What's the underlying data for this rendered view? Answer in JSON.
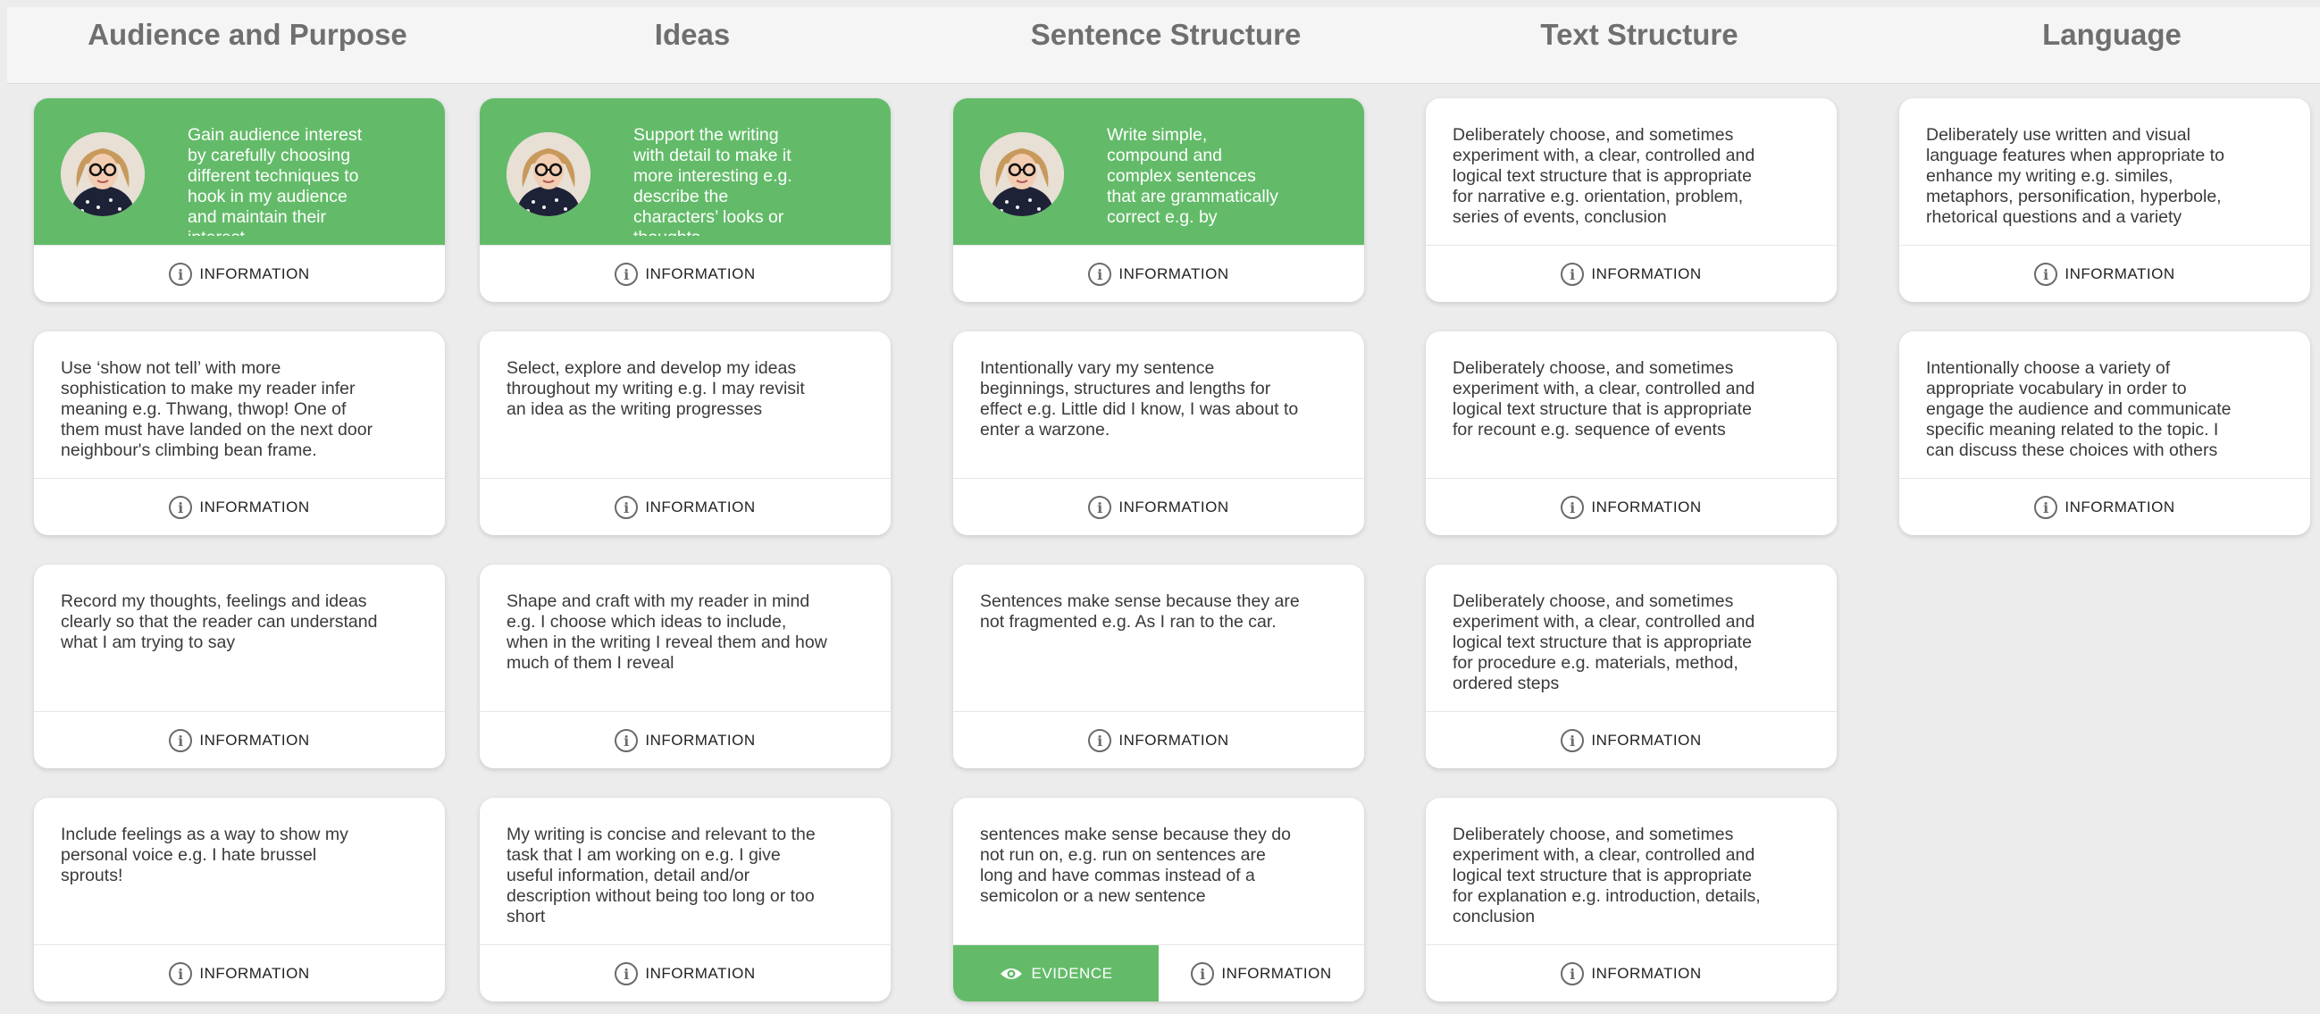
{
  "columns": [
    {
      "title": "Audience and Purpose",
      "cards": [
        {
          "text": "Gain audience interest by carefully choosing different techniques to hook in my audience and maintain their interest",
          "selected": true,
          "info_label": "INFORMATION"
        },
        {
          "text": "Use ‘show not tell’ with more sophistication to make my reader infer meaning e.g. Thwang, thwop! One of them must have landed on the next door neighbour's climbing bean frame.",
          "info_label": "INFORMATION"
        },
        {
          "text": "Record my thoughts, feelings and ideas clearly so that the reader can understand what I am trying to say",
          "info_label": "INFORMATION"
        },
        {
          "text": "Include feelings as a way to show my personal voice e.g. I hate brussel sprouts!",
          "info_label": "INFORMATION"
        }
      ]
    },
    {
      "title": "Ideas",
      "cards": [
        {
          "text": "Support the writing with detail to make it more interesting e.g. describe the characters’ looks or thoughts",
          "selected": true,
          "info_label": "INFORMATION"
        },
        {
          "text": "Select, explore and develop my ideas throughout my writing e.g. I may revisit an idea as the writing progresses",
          "info_label": "INFORMATION"
        },
        {
          "text": "Shape and craft with my reader in mind e.g. I choose which ideas to include, when in the writing I reveal them and how much of them I reveal",
          "info_label": "INFORMATION"
        },
        {
          "text": "My writing is concise and relevant to the task that I am working on e.g. I give useful information, detail and/or description without being too long or too short",
          "info_label": "INFORMATION"
        }
      ]
    },
    {
      "title": "Sentence Structure",
      "cards": [
        {
          "text": "Write simple, compound and complex sentences that are grammatically correct e.g. by",
          "selected": true,
          "info_label": "INFORMATION"
        },
        {
          "text": "Intentionally vary my sentence beginnings, structures and lengths for effect e.g. Little did I know, I was about to enter a warzone.",
          "info_label": "INFORMATION"
        },
        {
          "text": "Sentences make sense because they are not fragmented e.g. As I ran to the car.",
          "info_label": "INFORMATION"
        },
        {
          "text": "sentences make sense because they do not run on, e.g. run on sentences are long and have commas instead of a semicolon or a new sentence",
          "info_label": "INFORMATION",
          "evidence_label": "EVIDENCE"
        }
      ]
    },
    {
      "title": "Text Structure",
      "cards": [
        {
          "text": "Deliberately choose, and sometimes experiment with, a clear, controlled and logical text structure that is appropriate for narrative e.g. orientation, problem, series of events, conclusion",
          "info_label": "INFORMATION"
        },
        {
          "text": "Deliberately choose, and sometimes experiment with, a clear, controlled and logical text structure that is appropriate for recount e.g. sequence of events",
          "info_label": "INFORMATION"
        },
        {
          "text": "Deliberately choose, and sometimes experiment with, a clear, controlled and logical text structure that is appropriate for procedure e.g. materials, method, ordered steps",
          "info_label": "INFORMATION"
        },
        {
          "text": "Deliberately choose, and sometimes experiment with, a clear, controlled and logical text structure that is appropriate for explanation e.g. introduction, details, conclusion",
          "info_label": "INFORMATION"
        }
      ]
    },
    {
      "title": "Language",
      "cards": [
        {
          "text": "Deliberately use written and visual language features when appropriate to enhance my writing e.g. similes, metaphors, personification, hyperbole, rhetorical questions and a variety",
          "info_label": "INFORMATION"
        },
        {
          "text": "Intentionally choose a variety of appropriate vocabulary in order to engage the audience and communicate specific meaning related to the topic. I can discuss these choices with others",
          "info_label": "INFORMATION"
        }
      ]
    }
  ],
  "colors": {
    "accent": "#63bb69",
    "background": "#ececec",
    "card": "#ffffff",
    "header_text": "#6f6f6f"
  },
  "icons": {
    "info": "info-icon",
    "evidence": "eye-icon",
    "avatar": "student-avatar"
  }
}
